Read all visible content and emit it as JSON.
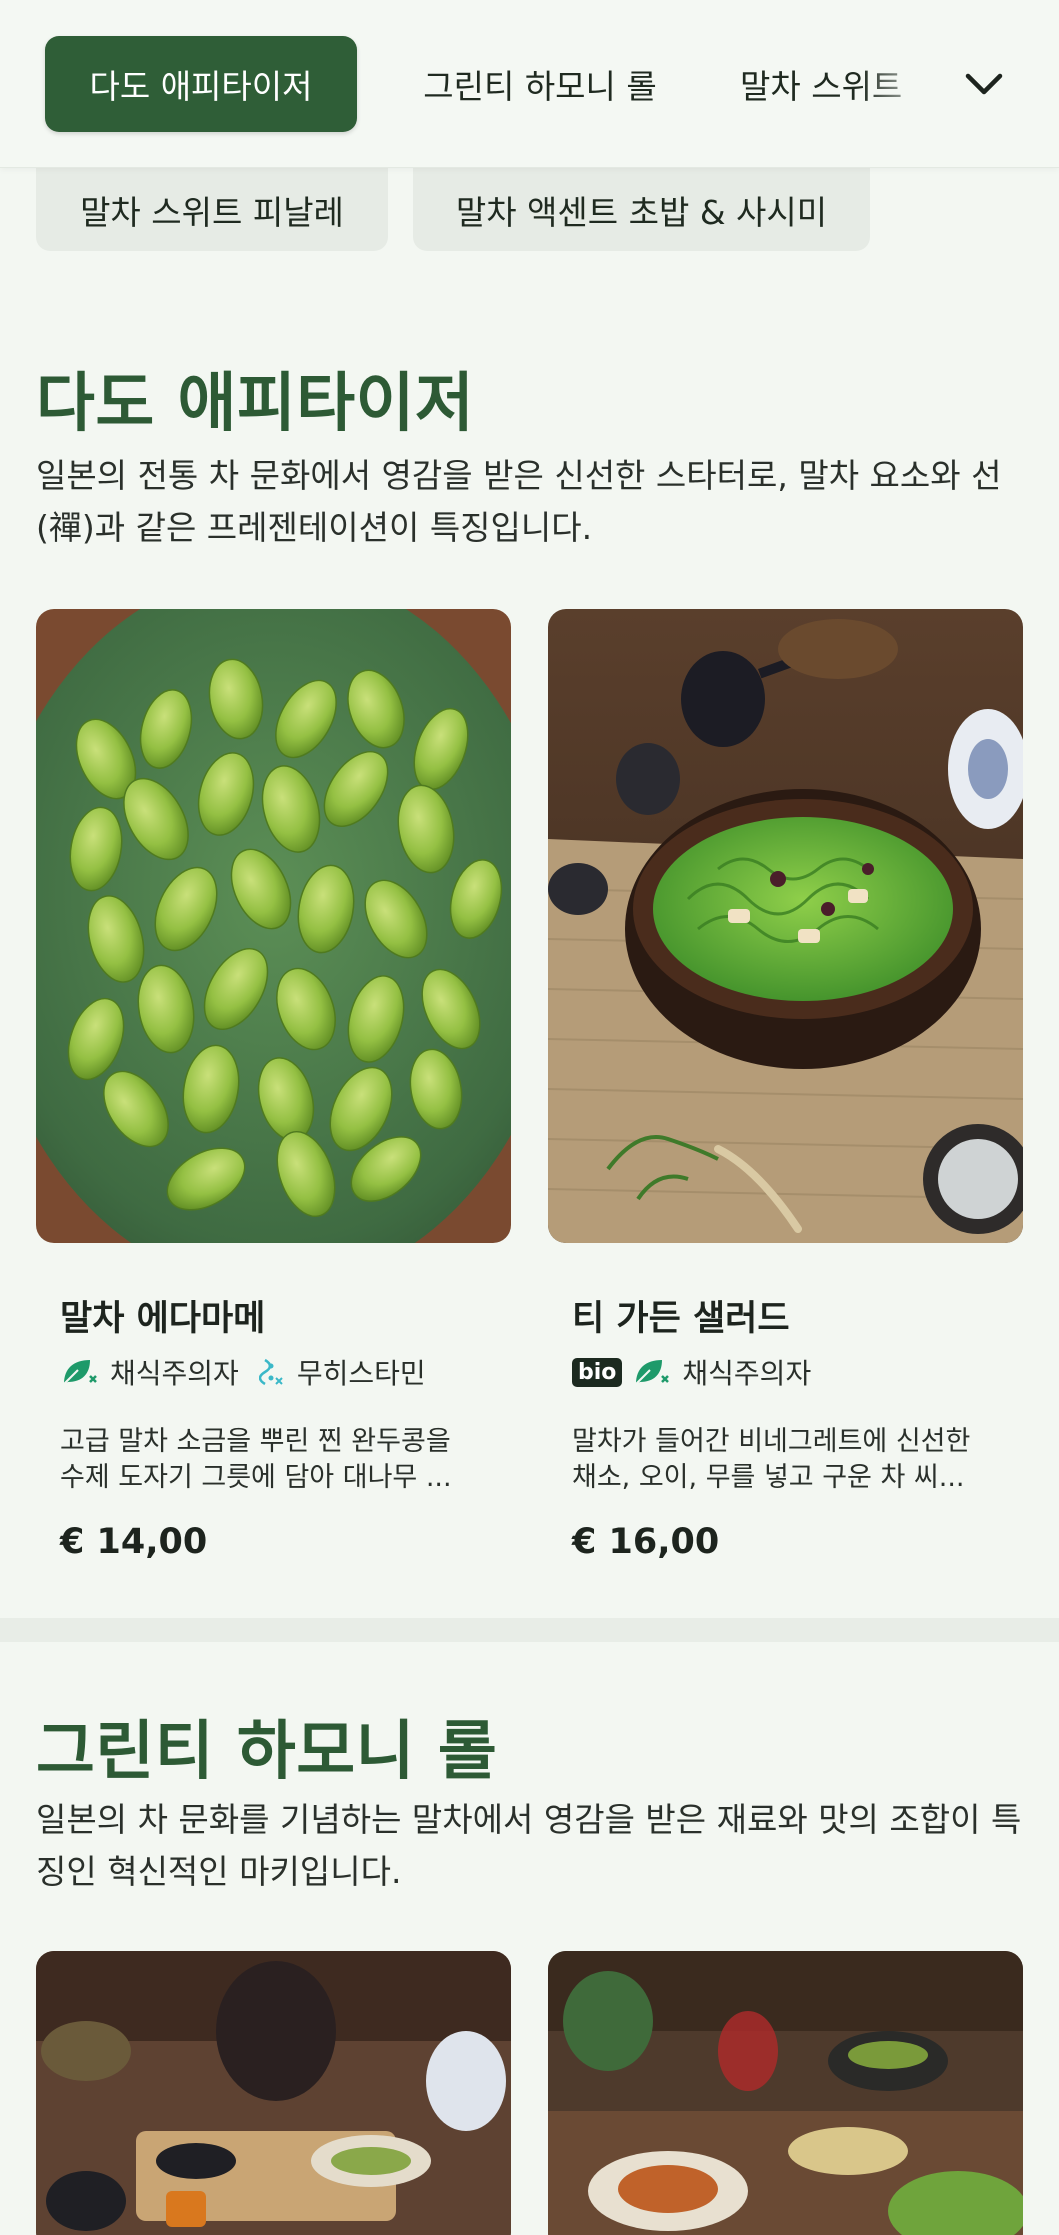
{
  "categories": [
    {
      "label": "다도 애피타이저",
      "active": true
    },
    {
      "label": "그린티 하모니 롤",
      "active": false
    },
    {
      "label": "말차 스위트 피날레",
      "active": false
    },
    {
      "label": "말차 액센트 초밥 & 사시미",
      "active": false
    }
  ],
  "top_tab3_visible": "말차 스위트",
  "sections": [
    {
      "title": "다도 애피타이저",
      "description": "일본의 전통 차 문화에서 영감을 받은 신선한 스타터로, 말차 요소와 선(禪)과 같은 프레젠테이션이 특징입니다.",
      "dishes": [
        {
          "name": "말차 에다마메",
          "tags": [
            "채식주의자",
            "무히스타민"
          ],
          "description": "고급 말차 소금을 뿌린 찐 완두콩을 수제 도자기 그릇에 담아 대나무 ...",
          "price": "€ 14,00"
        },
        {
          "name": "티 가든 샐러드",
          "badge": "bio",
          "tags": [
            "채식주의자"
          ],
          "description": "말차가 들어간 비네그레트에 신선한 채소, 오이, 무를 넣고 구운 차 씨...",
          "price": "€ 16,00"
        }
      ]
    },
    {
      "title": "그린티 하모니 롤",
      "description": "일본의 차 문화를 기념하는 말차에서 영감을 받은 재료와 맛의 조합이 특징인 혁신적인 마키입니다."
    }
  ],
  "colors": {
    "accent": "#2f5e37",
    "background": "#f3f7f2",
    "vegan_icon": "#1e9a6a",
    "antihistamine_icon": "#3ab8c8"
  },
  "icons": {
    "expand": "chevron-down-icon",
    "vegan": "leaf-icon",
    "histamine": "antihistamine-icon"
  }
}
